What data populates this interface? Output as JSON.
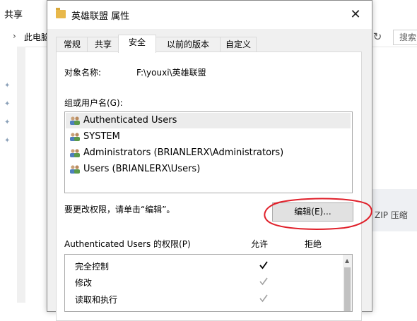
{
  "explorer": {
    "share_tab": "共享",
    "breadcrumb": "此电脑",
    "search_placeholder": "搜索",
    "zip_text": "ZIP 压缩"
  },
  "dialog": {
    "title": "英雄联盟 属性",
    "tabs": [
      {
        "label": "常规"
      },
      {
        "label": "共享"
      },
      {
        "label": "安全"
      },
      {
        "label": "以前的版本"
      },
      {
        "label": "自定义"
      }
    ],
    "active_tab": "安全",
    "object_name_label": "对象名称:",
    "object_name_value": "F:\\youxi\\英雄联盟",
    "group_label": "组或用户名(G):",
    "users": [
      {
        "label": "Authenticated Users"
      },
      {
        "label": "SYSTEM"
      },
      {
        "label": "Administrators (BRIANLERX\\Administrators)"
      },
      {
        "label": "Users (BRIANLERX\\Users)"
      }
    ],
    "hint": "要更改权限，请单击“编辑”。",
    "edit_button": "编辑(E)...",
    "permissions_label": "Authenticated Users 的权限(P)",
    "allow_header": "允许",
    "deny_header": "拒绝",
    "permissions": [
      {
        "name": "完全控制",
        "allow": true,
        "allow_style": "dark"
      },
      {
        "name": "修改",
        "allow": true,
        "allow_style": "gray"
      },
      {
        "name": "读取和执行",
        "allow": true,
        "allow_style": "gray"
      }
    ]
  },
  "colors": {
    "annotation_circle": "#e0202a",
    "folder": "#e8b84a",
    "dialog_bg": "#f0f0f0"
  }
}
